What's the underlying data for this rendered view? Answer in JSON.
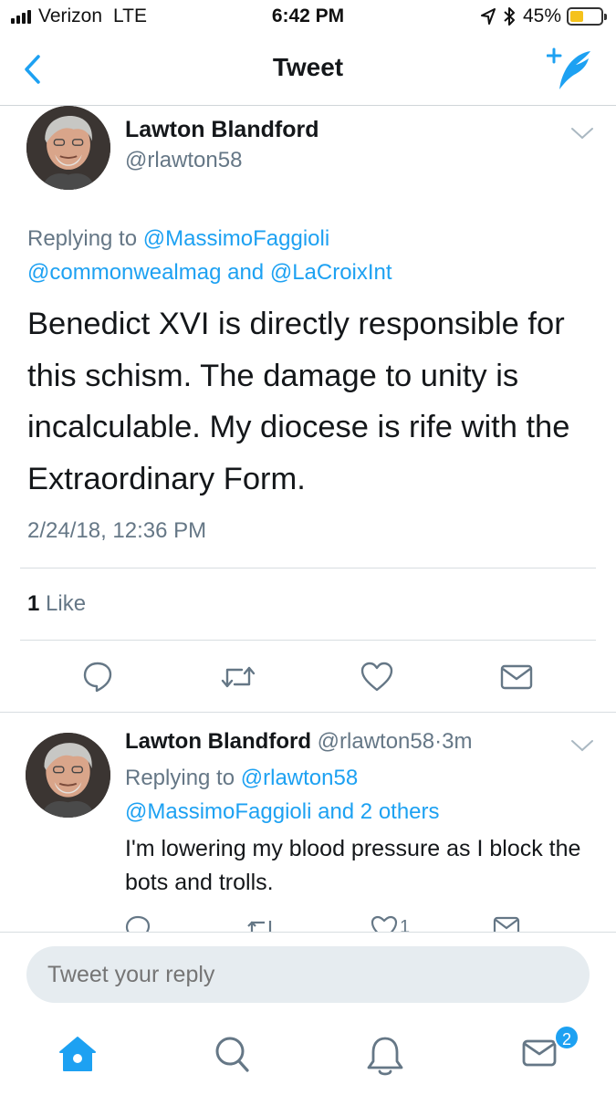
{
  "status_bar": {
    "carrier": "Verizon",
    "network": "LTE",
    "time": "6:42 PM",
    "battery_percent": "45%",
    "battery_level": 0.45,
    "icons": [
      "signal-bars-icon",
      "location-arrow-icon",
      "bluetooth-icon",
      "battery-icon"
    ]
  },
  "nav": {
    "title": "Tweet",
    "back_icon": "chevron-left-icon",
    "compose_icon": "compose-tweet-icon"
  },
  "tweet": {
    "author_name": "Lawton Blandford",
    "author_handle": "@rlawton58",
    "replying_to_label": "Replying to",
    "mention_1": "@MassimoFaggioli",
    "mention_2": "@commonwealmag",
    "conjunction": "and",
    "mention_3": "@LaCroixInt",
    "text": "Benedict XVI is directly responsible for this schism. The damage to unity is incalculable. My diocese is rife with the Extraordinary Form.",
    "timestamp": "2/24/18, 12:36 PM",
    "like_count": "1",
    "like_label": "Like",
    "actions": [
      "reply-icon",
      "retweet-icon",
      "like-heart-icon",
      "direct-message-icon"
    ]
  },
  "reply": {
    "author_name": "Lawton Blandford",
    "author_handle": "@rlawton58",
    "separator": "·",
    "age": "3m",
    "replying_to_label": "Replying to",
    "mention_1": "@rlawton58",
    "mention_2": "@MassimoFaggioli",
    "others_text": "and 2 others",
    "text": "I'm lowering my blood pressure as I block the bots and trolls.",
    "like_count": "1"
  },
  "composer": {
    "placeholder": "Tweet your reply"
  },
  "tab_bar": {
    "tabs": [
      "home-icon",
      "search-icon",
      "notifications-bell-icon",
      "messages-icon"
    ],
    "messages_badge": "2"
  },
  "colors": {
    "accent": "#1da1f2",
    "text_primary": "#14171a",
    "text_secondary": "#657786",
    "input_background": "#e6ecf0",
    "battery_fill": "#f5c21b"
  }
}
